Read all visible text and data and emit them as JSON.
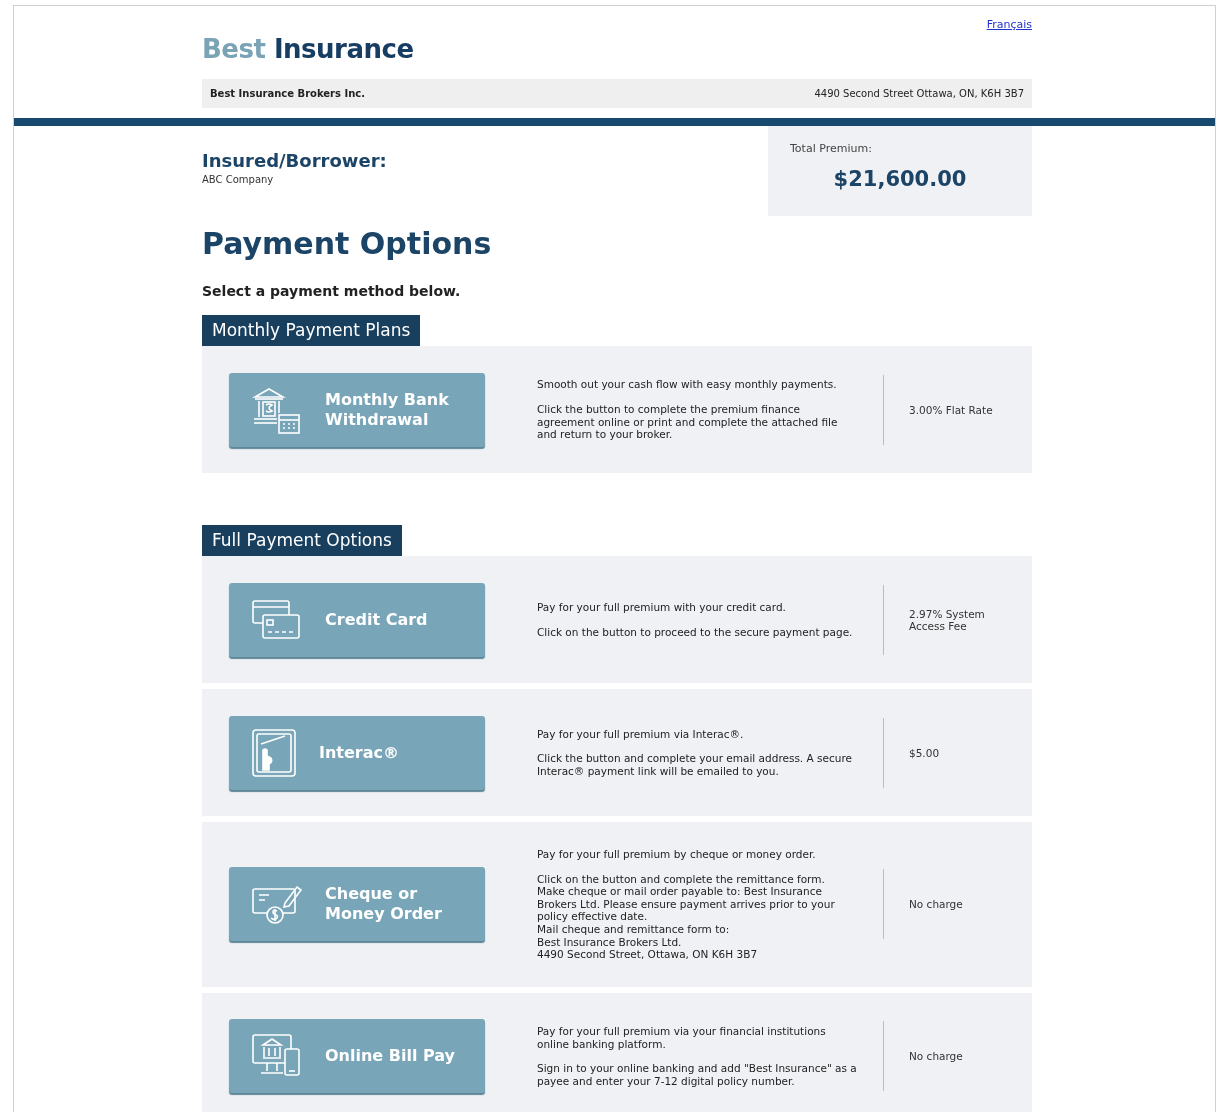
{
  "language_link": "Français",
  "logo": {
    "first": "Best",
    "second": "Insurance"
  },
  "company_bar": {
    "name": "Best Insurance Brokers Inc.",
    "address": "4490 Second Street Ottawa, ON, K6H 3B7"
  },
  "insured": {
    "label": "Insured/Borrower:",
    "name": "ABC Company"
  },
  "total_premium": {
    "label": "Total Premium:",
    "amount": "$21,600.00"
  },
  "title": "Payment Options",
  "instruction": "Select a payment method below.",
  "sections": [
    {
      "title": "Monthly Payment Plans",
      "options": [
        {
          "kind": "bank",
          "button": "Monthly Bank Withdrawal",
          "description": [
            "Smooth out your cash flow with easy monthly payments.",
            "Click the button to complete the premium finance agreement online or print and complete the attached file and return to your broker."
          ],
          "fee": "3.00% Flat Rate"
        }
      ]
    },
    {
      "title": "Full Payment Options",
      "options": [
        {
          "kind": "card",
          "button": "Credit Card",
          "description": [
            "Pay for your full premium with your credit card.",
            "Click on the button to proceed to the secure payment page."
          ],
          "fee": "2.97% System Access Fee"
        },
        {
          "kind": "interac",
          "button": "Interac®",
          "description": [
            "Pay for your full premium via Interac®.",
            "Click the button and complete your email address. A secure Interac® payment link will be emailed to you."
          ],
          "fee": "$5.00"
        },
        {
          "kind": "cheque",
          "button": "Cheque or Money Order",
          "description": [
            "Pay for your full premium by cheque or money order.",
            "Click on the button and complete the remittance form.\nMake cheque or mail order payable to: Best Insurance Brokers Ltd. Please ensure payment arrives prior to your policy effective date.\nMail cheque and remittance form to:\nBest Insurance Brokers Ltd.\n4490 Second Street, Ottawa, ON K6H 3B7"
          ],
          "fee": "No charge"
        },
        {
          "kind": "online",
          "button": "Online Bill Pay",
          "description": [
            "Pay for your full premium via your financial institutions online banking platform.",
            "Sign in to your online banking and add \"Best Insurance\" as a payee and enter your 7-12 digital policy number."
          ],
          "fee": "No charge"
        }
      ]
    }
  ]
}
